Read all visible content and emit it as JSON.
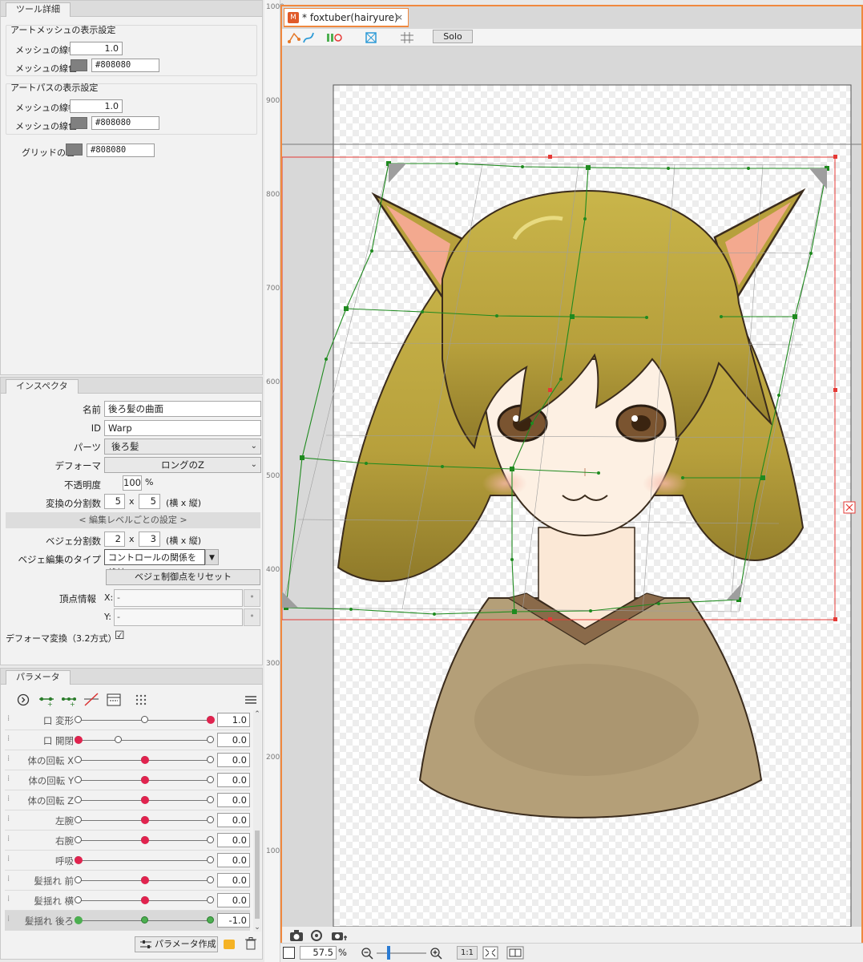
{
  "tool_detail": {
    "tab": "ツール詳細",
    "art_mesh": {
      "title": "アートメッシュの表示設定",
      "line_width_label": "メッシュの線幅",
      "line_width_value": "1.0",
      "line_color_label": "メッシュの線色",
      "line_color_value": "#808080"
    },
    "art_path": {
      "title": "アートパスの表示設定",
      "line_width_label": "メッシュの線幅",
      "line_width_value": "1.0",
      "line_color_label": "メッシュの線色",
      "line_color_value": "#808080"
    },
    "grid_color_label": "グリッドの色",
    "grid_color_value": "#808080",
    "swatch_color": "#808080"
  },
  "inspector": {
    "tab": "インスペクタ",
    "name_label": "名前",
    "name_value": "後ろ髪の曲面",
    "id_label": "ID",
    "id_value": "Warp",
    "parts_label": "パーツ",
    "parts_value": "後ろ髪",
    "deformer_label": "デフォーマ",
    "deformer_value": "ロングのZ",
    "opacity_label": "不透明度",
    "opacity_value": "100",
    "opacity_unit": "%",
    "division_label": "変換の分割数",
    "division_x": "5",
    "division_y": "5",
    "times": "x",
    "division_hint": "(横 x 縦)",
    "level_band": "< 編集レベルごとの設定 >",
    "bezier_div_label": "ベジェ分割数",
    "bezier_x": "2",
    "bezier_y": "3",
    "bezier_hint": "(横 x 縦)",
    "bezier_type_label": "ベジェ編集のタイプ",
    "bezier_type_value": "コントロールの関係を維持",
    "reset_button": "ベジェ制御点をリセット",
    "vertex_label": "頂点情報",
    "vertex_x_label": "X:",
    "vertex_x_value": "-",
    "vertex_y_label": "Y:",
    "vertex_y_value": "-",
    "deform32_label": "デフォーマ変換（3.2方式）",
    "deform32_checked": "☑"
  },
  "parameters": {
    "tab": "パラメータ",
    "rows": [
      {
        "name": "口 変形",
        "value": "1.0",
        "pos": 1.0,
        "knots": [
          0,
          0.5,
          1
        ]
      },
      {
        "name": "口 開閉",
        "value": "0.0",
        "pos": 0.0,
        "knots": [
          0,
          0.3,
          1
        ]
      },
      {
        "name": "体の回転 X",
        "value": "0.0",
        "pos": 0.5,
        "knots": [
          0,
          0.5,
          1
        ]
      },
      {
        "name": "体の回転 Y",
        "value": "0.0",
        "pos": 0.5,
        "knots": [
          0,
          0.5,
          1
        ]
      },
      {
        "name": "体の回転 Z",
        "value": "0.0",
        "pos": 0.5,
        "knots": [
          0,
          0.5,
          1
        ]
      },
      {
        "name": "左腕",
        "value": "0.0",
        "pos": 0.5,
        "knots": [
          0,
          0.5,
          1
        ]
      },
      {
        "name": "右腕",
        "value": "0.0",
        "pos": 0.5,
        "knots": [
          0,
          0.5,
          1
        ]
      },
      {
        "name": "呼吸",
        "value": "0.0",
        "pos": 0.0,
        "knots": [
          0,
          1
        ]
      },
      {
        "name": "髪揺れ 前",
        "value": "0.0",
        "pos": 0.5,
        "knots": [
          0,
          0.5,
          1
        ]
      },
      {
        "name": "髪揺れ 横",
        "value": "0.0",
        "pos": 0.5,
        "knots": [
          0,
          0.5,
          1
        ]
      },
      {
        "name": "髪揺れ 後ろ",
        "value": "-1.0",
        "pos": 0.0,
        "knots": [
          0,
          0.5,
          1
        ]
      }
    ],
    "create_button": "パラメータ作成"
  },
  "ruler": {
    "ticks": [
      "1000",
      "900",
      "800",
      "700",
      "600",
      "500",
      "400",
      "300",
      "200",
      "100"
    ]
  },
  "document": {
    "tab_title": "* foxtuber(hairyure)",
    "mode_button": "Solo"
  },
  "status": {
    "zoom_value": "57.5",
    "zoom_unit": "%",
    "actual_size": "1:1"
  },
  "colors": {
    "accent": "#f0883e",
    "param_dot": "#e0234e",
    "warp_green": "#1f8a1f",
    "bbox_red": "#e53935"
  }
}
